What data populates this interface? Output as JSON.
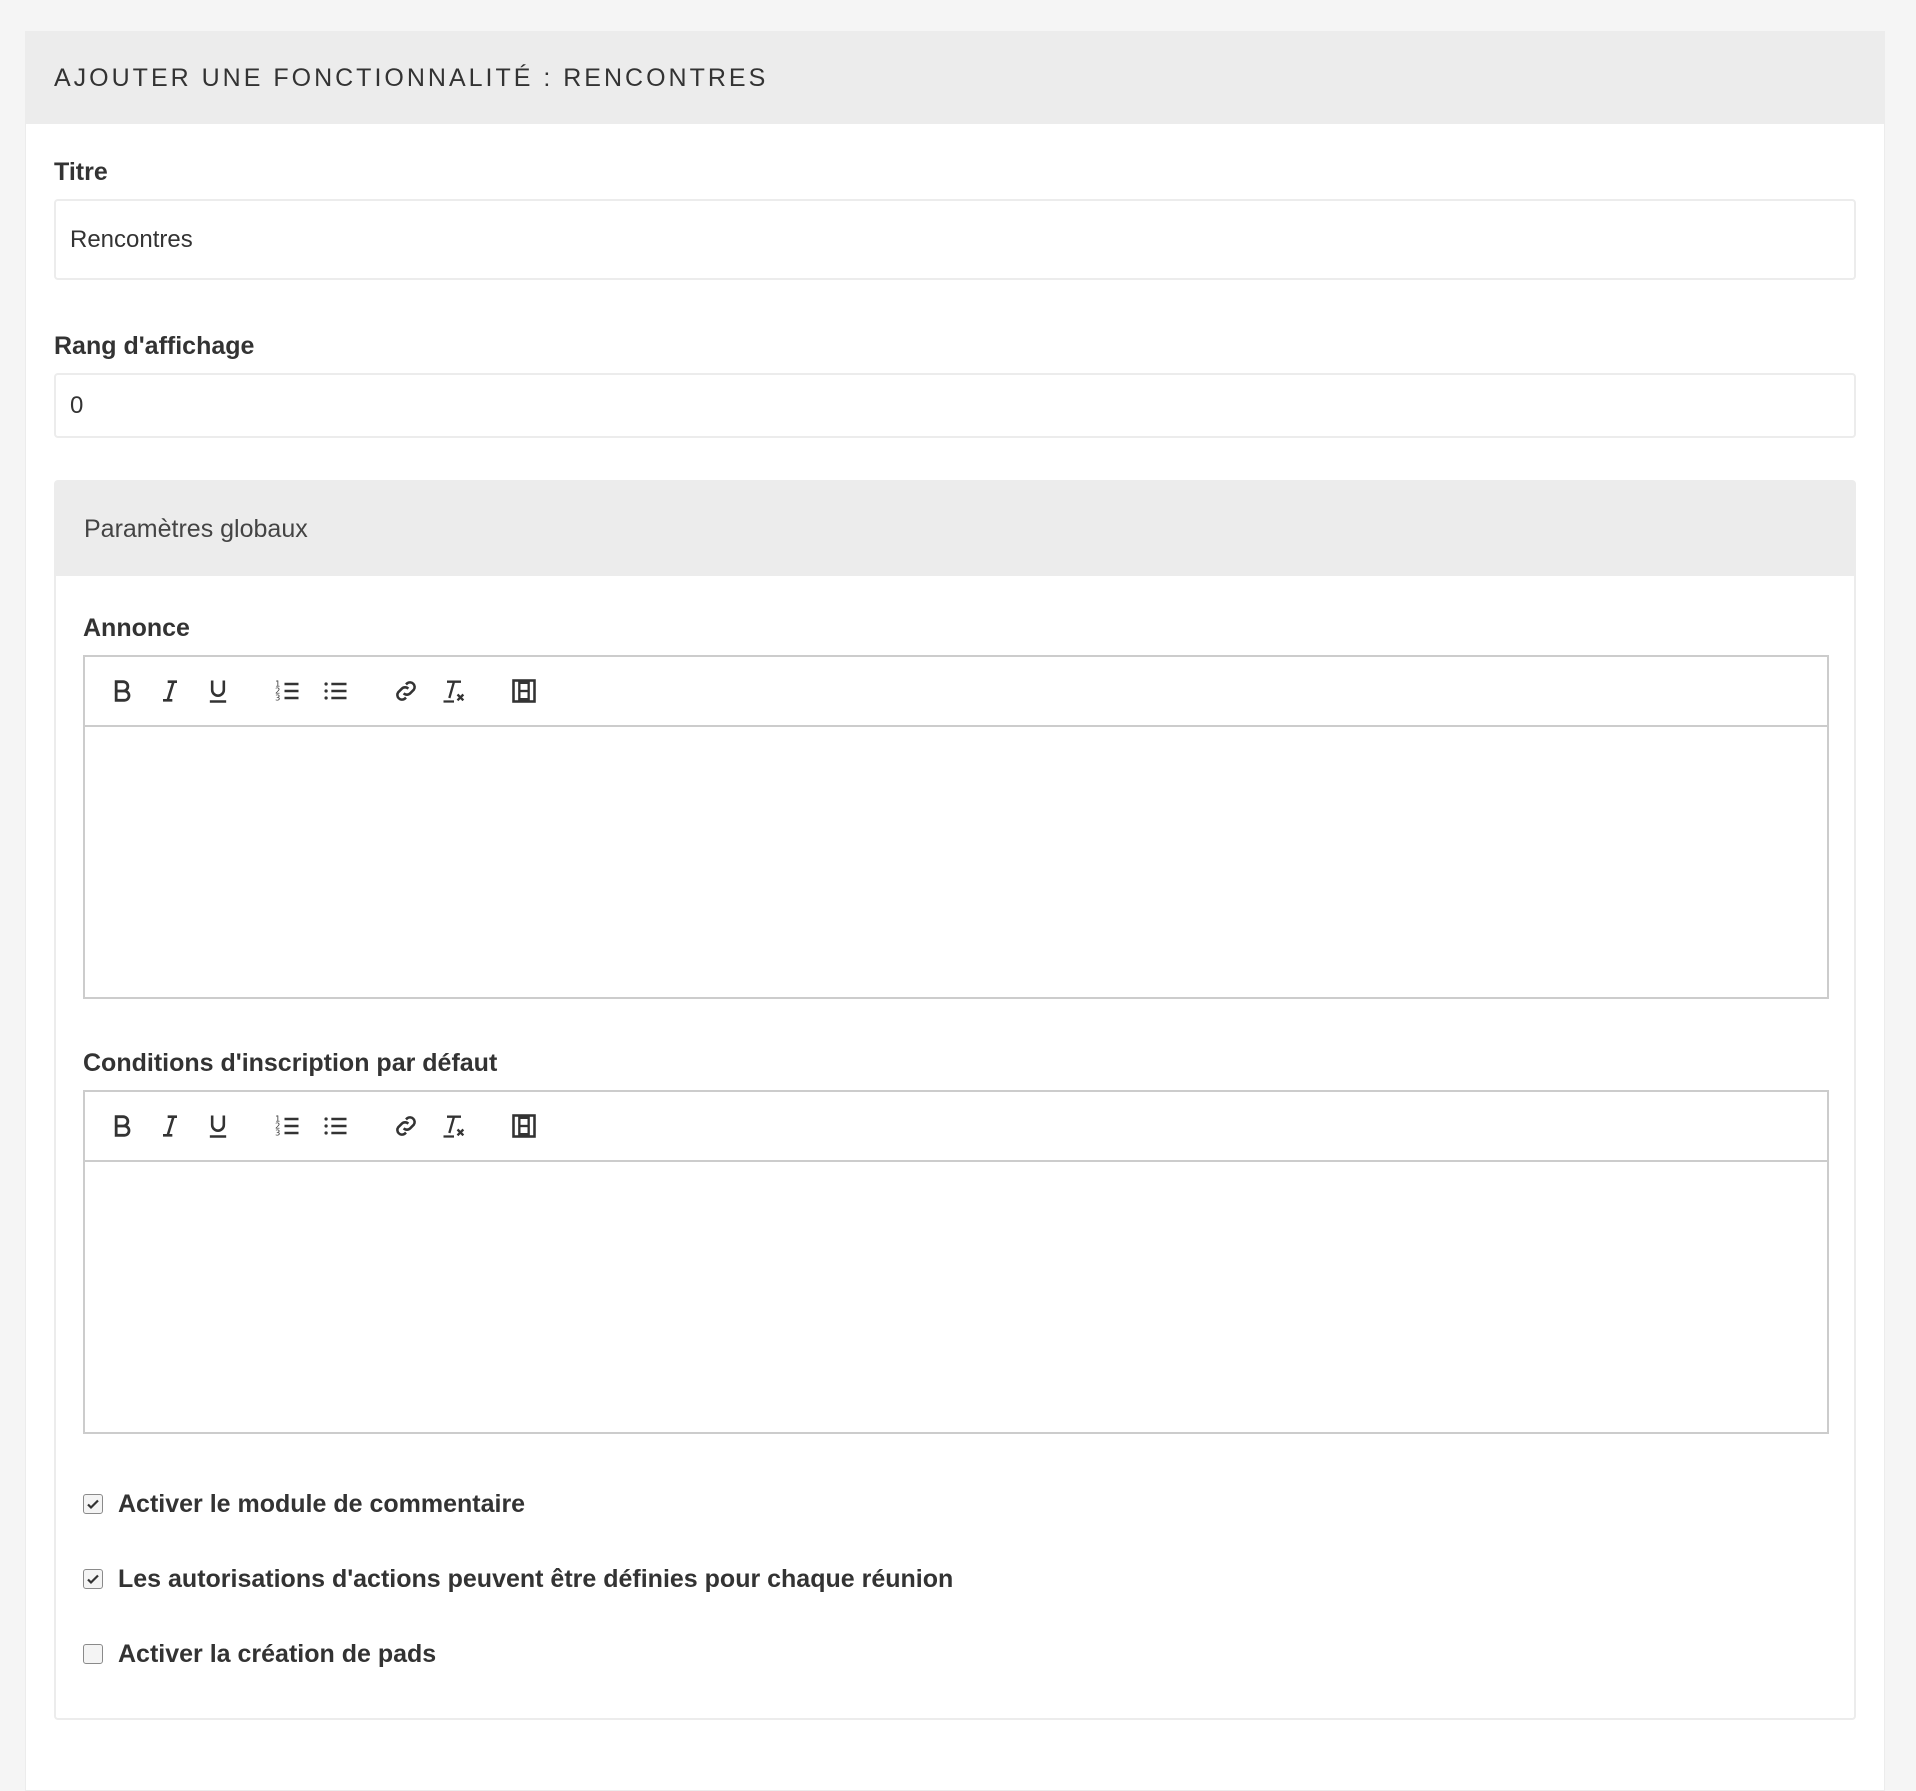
{
  "card": {
    "title": "AJOUTER UNE FONCTIONNALITÉ : RENCONTRES"
  },
  "fields": {
    "title": {
      "label": "Titre",
      "value": "Rencontres"
    },
    "rank": {
      "label": "Rang d'affichage",
      "value": "0"
    }
  },
  "global_settings": {
    "title": "Paramètres globaux",
    "editors": [
      {
        "label": "Annonce",
        "content": ""
      },
      {
        "label": "Conditions d'inscription par défaut",
        "content": ""
      }
    ],
    "toolbar_icons": [
      "bold-icon",
      "italic-icon",
      "underline-icon",
      "ordered-list-icon",
      "bullet-list-icon",
      "link-icon",
      "clear-format-icon",
      "video-icon"
    ],
    "checkboxes": [
      {
        "label": "Activer le module de commentaire",
        "checked": true
      },
      {
        "label": "Les autorisations d'actions peuvent être définies pour chaque réunion",
        "checked": true
      },
      {
        "label": "Activer la création de pads",
        "checked": false
      }
    ]
  },
  "colors": {
    "header_bg": "#ececec",
    "text": "#333333",
    "border": "#cccccc"
  }
}
